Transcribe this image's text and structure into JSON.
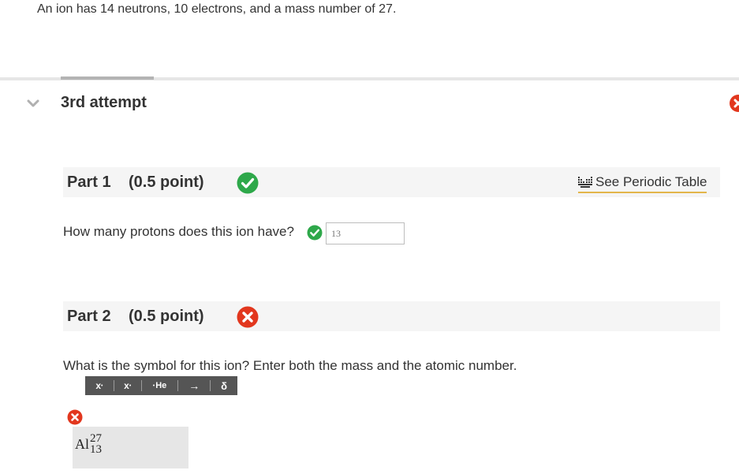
{
  "question": {
    "text": "An ion has 14 neutrons, 10 electrons, and a mass number of 27."
  },
  "attempt": {
    "title": "3rd attempt"
  },
  "periodic_table": {
    "label": "See Periodic Table"
  },
  "parts": [
    {
      "label": "Part 1",
      "points": "(0.5 point)",
      "status": "correct",
      "question": "How many protons does this ion have?",
      "answer": "13"
    },
    {
      "label": "Part 2",
      "points": "(0.5 point)",
      "status": "incorrect",
      "question": "What is the symbol for this ion? Enter both the mass and the atomic number.",
      "answer": {
        "symbol": "Al",
        "mass_number": "27",
        "atomic_number": "13"
      }
    }
  ],
  "toolbar": {
    "superscript": "x",
    "subscript": "x",
    "isotope": "He",
    "arrow": "→",
    "delta": "δ"
  },
  "colors": {
    "correct": "#2ea84a",
    "incorrect": "#e2371e",
    "underline_accent": "#e3b64b"
  },
  "icons": {
    "collapse": "chevron-down-icon",
    "correct": "check-circle-icon",
    "incorrect": "x-circle-icon",
    "periodic": "periodic-table-icon"
  }
}
